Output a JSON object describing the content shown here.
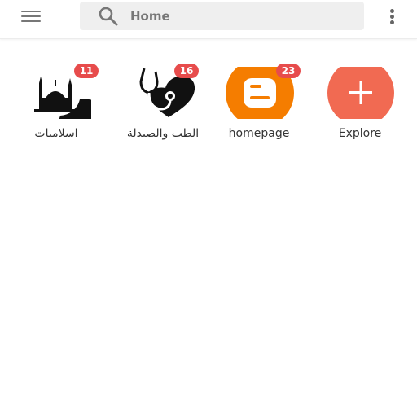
{
  "header": {
    "menu_icon": "hamburger-menu-icon",
    "search": {
      "placeholder": "Home",
      "icon": "search-icon"
    },
    "more_icon": "more-vertical-icon"
  },
  "tiles": [
    {
      "label": "اسلاميات",
      "badge": "11",
      "icon": "mosque-crescent-icon"
    },
    {
      "label": "الطب والصيدلة",
      "badge": "16",
      "icon": "stethoscope-heart-icon"
    },
    {
      "label": "homepage",
      "badge": "23",
      "icon": "blogger-icon"
    },
    {
      "label": "Explore",
      "badge": "",
      "icon": "plus-circle-icon"
    }
  ],
  "colors": {
    "badge": "#e74c4c",
    "blogger": "#f57d00",
    "explore": "#f16a52",
    "search_bg": "#efefef"
  }
}
